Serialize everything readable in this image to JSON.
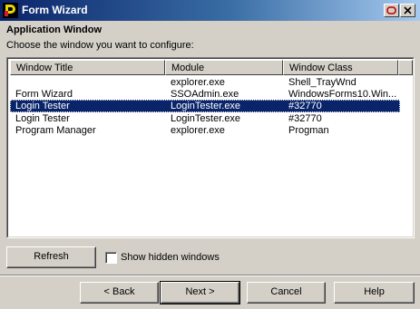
{
  "window": {
    "title": "Form Wizard",
    "icon": "redirect-logo-icon"
  },
  "header": {
    "section_title": "Application Window",
    "subtitle": "Choose the window you want to configure:"
  },
  "list": {
    "columns": [
      "Window Title",
      "Module",
      "Window Class"
    ],
    "rows": [
      {
        "title": "",
        "module": "explorer.exe",
        "class": "Shell_TrayWnd",
        "selected": false
      },
      {
        "title": "Form Wizard",
        "module": "SSOAdmin.exe",
        "class": "WindowsForms10.Win...",
        "selected": false
      },
      {
        "title": "Login Tester",
        "module": "LoginTester.exe",
        "class": "#32770",
        "selected": true
      },
      {
        "title": "Login Tester",
        "module": "LoginTester.exe",
        "class": "#32770",
        "selected": false
      },
      {
        "title": "Program Manager",
        "module": "explorer.exe",
        "class": "Progman",
        "selected": false
      }
    ]
  },
  "controls": {
    "refresh_label": "Refresh",
    "show_hidden_label": "Show hidden windows",
    "show_hidden_checked": false
  },
  "nav": {
    "back_label": "< Back",
    "next_label": "Next >",
    "cancel_label": "Cancel",
    "help_label": "Help"
  },
  "colors": {
    "titlebar_start": "#0a246a",
    "titlebar_end": "#a6caf0",
    "selection": "#0a246a",
    "face": "#d4d0c8"
  }
}
